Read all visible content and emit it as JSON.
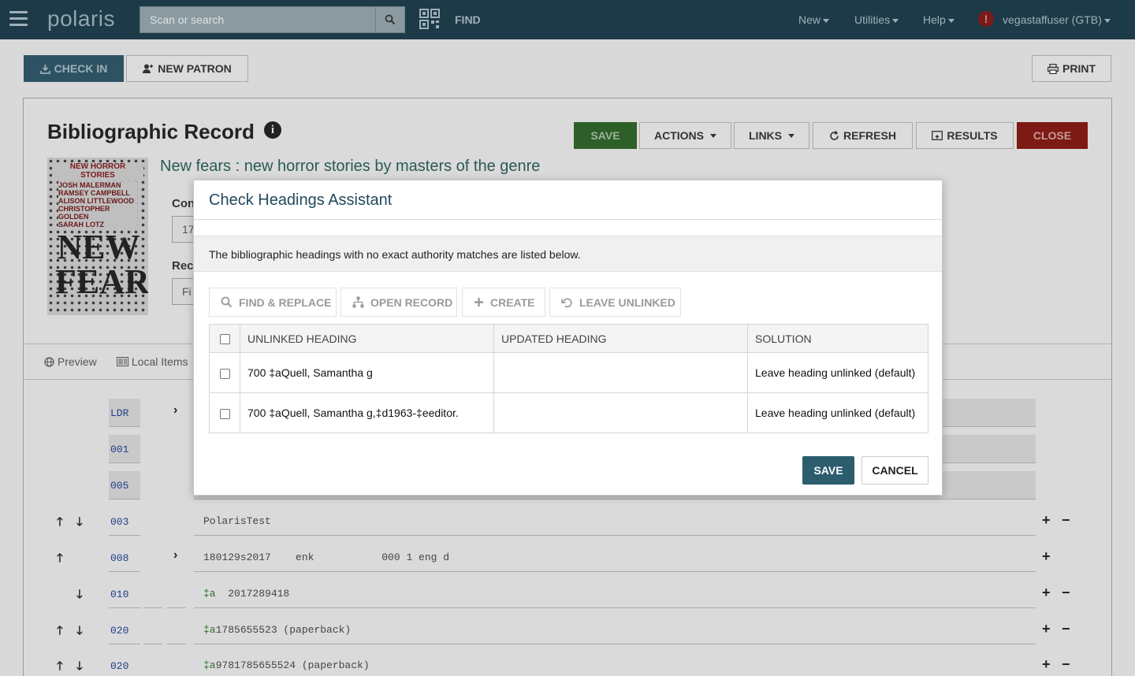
{
  "topbar": {
    "logo": "polaris",
    "search_placeholder": "Scan or search",
    "find_label": "FIND",
    "nav_new": "New",
    "nav_utilities": "Utilities",
    "nav_help": "Help",
    "alert_glyph": "!",
    "user": "vegastaffuser (GTB)"
  },
  "toolbar": {
    "checkin": "CHECK IN",
    "new_patron": "NEW PATRON",
    "print": "PRINT"
  },
  "record": {
    "heading": "Bibliographic Record",
    "info_glyph": "i",
    "save": "SAVE",
    "actions": "ACTIONS",
    "links": "LINKS",
    "refresh": "REFRESH",
    "results": "RESULTS",
    "close": "CLOSE",
    "title": "New fears : new horror stories by masters of the genre",
    "control_label": "Con",
    "control_value": "17",
    "record_label": "Rec",
    "record_value": "Fi",
    "cover": {
      "header": "NEW HORROR STORIES",
      "authors": [
        "JOSH MALERMAN",
        "RAMSEY CAMPBELL",
        "ALISON LITTLEWOOD",
        "CHRISTOPHER GOLDEN",
        "SARAH LOTZ"
      ],
      "big_title_1": "NEW",
      "big_title_2": "FEARS"
    }
  },
  "tabs": {
    "preview": "Preview",
    "local_items": "Local Items"
  },
  "marc_rows": [
    {
      "tag": "LDR",
      "content": ""
    },
    {
      "tag": "001",
      "content": ""
    },
    {
      "tag": "005",
      "content": ""
    },
    {
      "tag": "003",
      "content": "PolarisTest"
    },
    {
      "tag": "008",
      "content": "180129s2017    enk           000 1 eng d"
    },
    {
      "tag": "010",
      "sf": "‡a",
      "content": "  2017289418"
    },
    {
      "tag": "020",
      "sf": "‡a",
      "content": "1785655523 (paperback)"
    },
    {
      "tag": "020",
      "sf": "‡a",
      "content": "9781785655524 (paperback)"
    }
  ],
  "modal": {
    "title": "Check Headings Assistant",
    "info": "The bibliographic headings with no exact authority matches are listed below.",
    "find_replace": "FIND & REPLACE",
    "open_record": "OPEN RECORD",
    "create": "CREATE",
    "leave_unlinked": "LEAVE UNLINKED",
    "columns": [
      "UNLINKED HEADING",
      "UPDATED HEADING",
      "SOLUTION"
    ],
    "rows": [
      {
        "unlinked": "700 ‡aQuell, Samantha g",
        "updated": "",
        "solution": "Leave heading unlinked (default)"
      },
      {
        "unlinked": "700 ‡aQuell, Samantha g,‡d1963-‡eeditor.",
        "updated": "",
        "solution": "Leave heading unlinked (default)"
      }
    ],
    "save": "SAVE",
    "cancel": "CANCEL"
  },
  "colors": {
    "topbar": "#1d3a48",
    "accent": "#22495c",
    "save_green": "#2d5f28",
    "close_red": "#7d1a13"
  }
}
